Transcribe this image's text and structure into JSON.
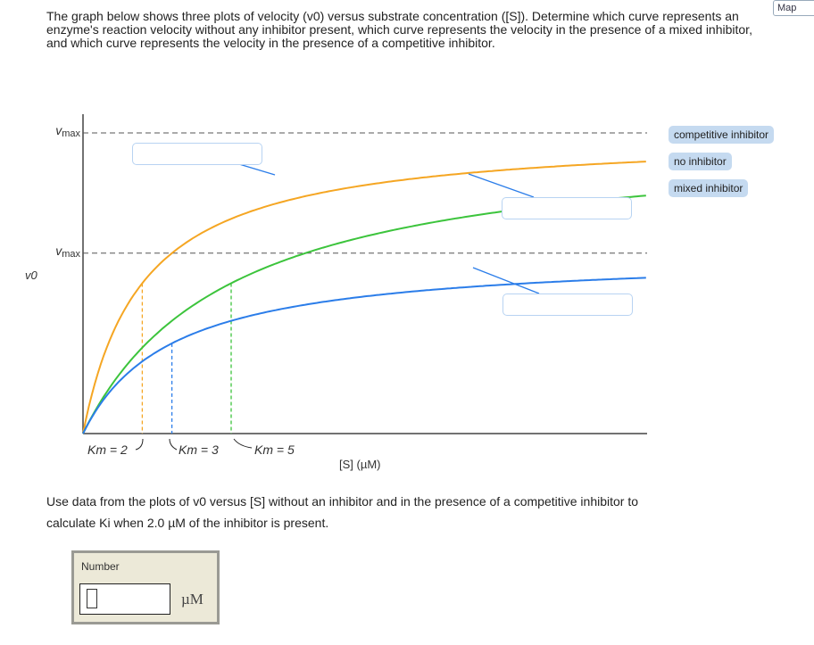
{
  "question1": "The graph below shows three plots of velocity (v0) versus substrate concentration ([S]). Determine which curve represents an enzyme's reaction velocity without any inhibitor present, which curve represents the velocity in the presence of a mixed inhibitor, and which curve represents the velocity in the presence of a competitive inhibitor.",
  "map_button": "Map",
  "chips": [
    "competitive inhibitor",
    "no inhibitor",
    "mixed inhibitor"
  ],
  "question2_a": "Use data from the plots of v0 versus [S] without an inhibitor and in the presence of a competitive inhibitor to",
  "question2_b": "calculate Ki when 2.0 µM of the inhibitor is present.",
  "answer": {
    "label": "Number",
    "value": "",
    "unit": "µM"
  },
  "chart_data": {
    "type": "line",
    "xlabel": "[S] (µM)",
    "ylabel": "v0",
    "xlim": [
      0,
      19
    ],
    "ylim": [
      0,
      1.06
    ],
    "vmax_label": "vmax",
    "vmax_levels": [
      1.0,
      0.6
    ],
    "series": [
      {
        "color": "#f5a623",
        "vmax": 1.0,
        "km": 2,
        "km_label": "Km = 2"
      },
      {
        "color": "#3cc43c",
        "vmax": 1.0,
        "km": 5,
        "km_label": "Km = 5"
      },
      {
        "color": "#2b7de9",
        "vmax": 0.6,
        "km": 3,
        "km_label": "Km = 3"
      }
    ]
  }
}
